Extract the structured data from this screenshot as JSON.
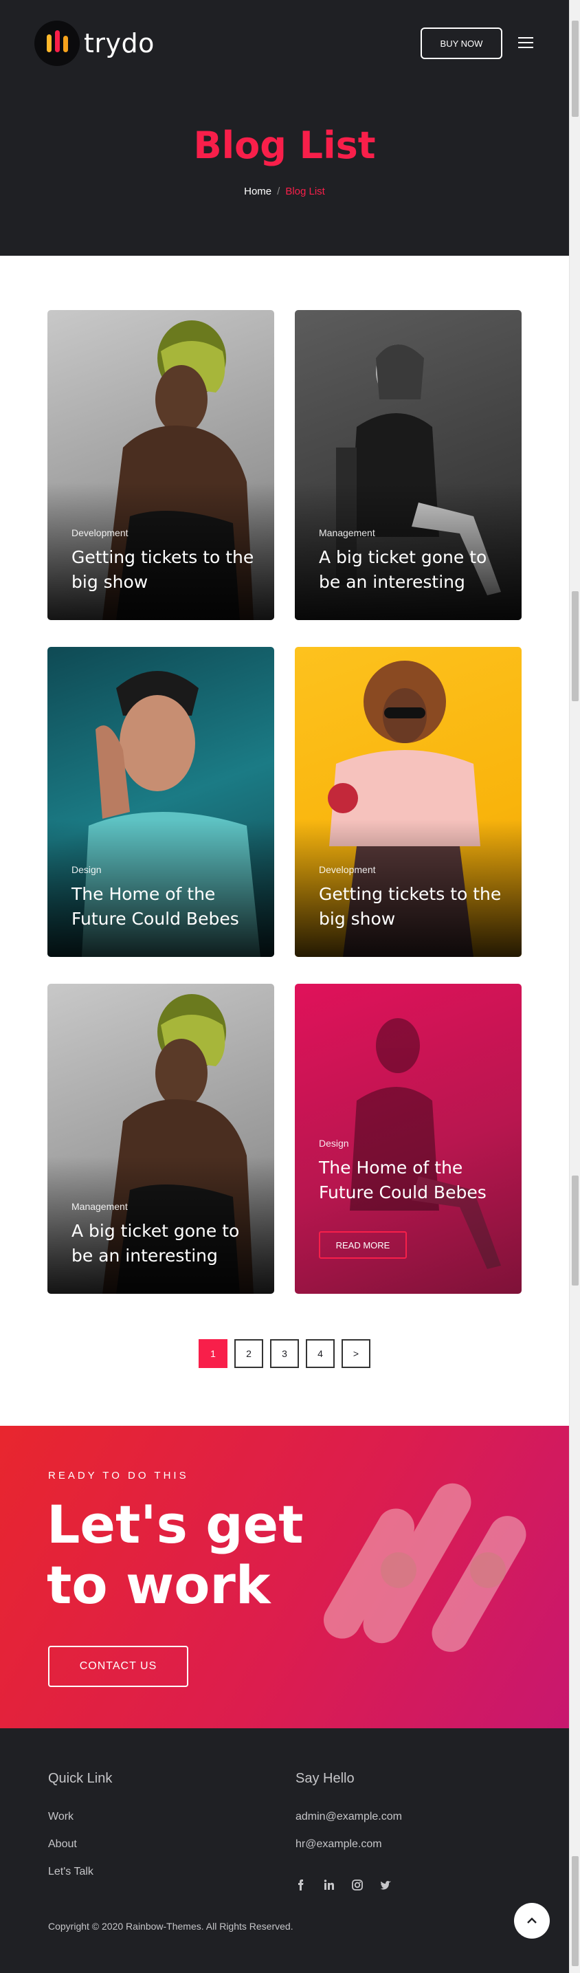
{
  "header": {
    "logo_text": "trydo",
    "buy_label": "BUY NOW",
    "logo_colors": [
      "#f81f4a",
      "#fdb82b",
      "#f6a21c"
    ]
  },
  "hero": {
    "title": "Blog List",
    "breadcrumb_home": "Home",
    "breadcrumb_sep": "/",
    "breadcrumb_current": "Blog List"
  },
  "posts": [
    {
      "category": "Development",
      "title": "Getting tickets to the big show"
    },
    {
      "category": "Management",
      "title": "A big ticket gone to be an interesting"
    },
    {
      "category": "Design",
      "title": "The Home of the Future Could Bebes"
    },
    {
      "category": "Development",
      "title": "Getting tickets to the big show"
    },
    {
      "category": "Management",
      "title": "A big ticket gone to be an interesting"
    },
    {
      "category": "Design",
      "title": "The Home of the Future Could Bebes",
      "button": "READ MORE"
    }
  ],
  "pagination": {
    "pages": [
      "1",
      "2",
      "3",
      "4"
    ],
    "next": ">",
    "active_page": "1"
  },
  "cta": {
    "kicker": "READY TO DO THIS",
    "title": "Let's get to work",
    "button": "CONTACT US"
  },
  "footer": {
    "quick_link_heading": "Quick Link",
    "links": [
      "Work",
      "About",
      "Let's Talk"
    ],
    "say_hello_heading": "Say Hello",
    "emails": [
      "admin@example.com",
      "hr@example.com"
    ],
    "social_icons": [
      "facebook-icon",
      "linkedin-icon",
      "instagram-icon",
      "twitter-icon"
    ],
    "copyright": "Copyright © 2020 Rainbow-Themes. All Rights Reserved."
  },
  "theme": {
    "accent": "#f81f4a",
    "dark": "#1f2024"
  }
}
